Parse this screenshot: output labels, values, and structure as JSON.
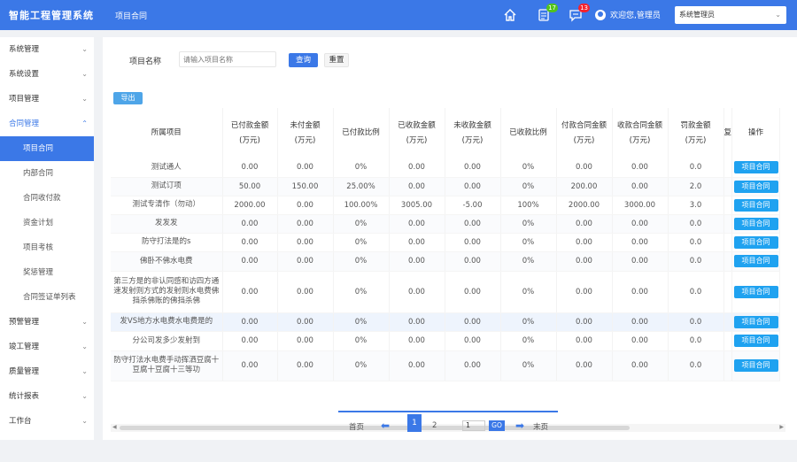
{
  "header": {
    "logo": "智能工程管理系统",
    "breadcrumb": "项目合同",
    "notify_count_1": "17",
    "notify_count_2": "13",
    "welcome": "欢迎您,管理员",
    "role_select": "系统管理员",
    "colors": {
      "primary": "#3b78e7",
      "badge_green": "#52c41a",
      "badge_red": "#f5222d"
    }
  },
  "sidebar": {
    "items": [
      {
        "label": "系统管理"
      },
      {
        "label": "系统设置"
      },
      {
        "label": "项目管理"
      },
      {
        "label": "合同管理"
      }
    ],
    "sub_items": [
      {
        "label": "项目合同"
      },
      {
        "label": "内部合同"
      },
      {
        "label": "合同收付款"
      },
      {
        "label": "资金计划"
      },
      {
        "label": "项目考核"
      },
      {
        "label": "奖惩管理"
      },
      {
        "label": "合同签证单列表"
      }
    ],
    "items_after": [
      {
        "label": "预警管理"
      },
      {
        "label": "竣工管理"
      },
      {
        "label": "质量管理"
      },
      {
        "label": "统计报表"
      },
      {
        "label": "工作台"
      }
    ]
  },
  "search": {
    "label": "项目名称",
    "placeholder": "请输入项目名称",
    "query_button": "查询",
    "reset_button": "重置"
  },
  "export_button": "导出",
  "table": {
    "headers": [
      "所属项目",
      "已付款金额\n(万元)",
      "未付金额\n(万元)",
      "已付款比例",
      "已收款金额\n(万元)",
      "未收款金额\n(万元)",
      "已收款比例",
      "付款合同金额\n(万元)",
      "收款合同金额\n(万元)",
      "罚款金额\n(万元)",
      "复",
      "操作"
    ],
    "rows": [
      {
        "cells": [
          "测试通人",
          "0.00",
          "0.00",
          "0%",
          "0.00",
          "0.00",
          "0%",
          "0.00",
          "0.00",
          "0.0"
        ],
        "action": "项目合同"
      },
      {
        "cells": [
          "测试订项",
          "50.00",
          "150.00",
          "25.00%",
          "0.00",
          "0.00",
          "0%",
          "200.00",
          "0.00",
          "2.0"
        ],
        "action": "项目合同"
      },
      {
        "cells": [
          "测试专清作（勿动）",
          "2000.00",
          "0.00",
          "100.00%",
          "3005.00",
          "-5.00",
          "100%",
          "2000.00",
          "3000.00",
          "3.0"
        ],
        "action": "项目合同"
      },
      {
        "cells": [
          "发发发",
          "0.00",
          "0.00",
          "0%",
          "0.00",
          "0.00",
          "0%",
          "0.00",
          "0.00",
          "0.0"
        ],
        "action": "项目合同"
      },
      {
        "cells": [
          "防守打法是的s",
          "0.00",
          "0.00",
          "0%",
          "0.00",
          "0.00",
          "0%",
          "0.00",
          "0.00",
          "0.0"
        ],
        "action": "项目合同"
      },
      {
        "cells": [
          "佛卧不佛水电费",
          "0.00",
          "0.00",
          "0%",
          "0.00",
          "0.00",
          "0%",
          "0.00",
          "0.00",
          "0.0"
        ],
        "action": "项目合同"
      },
      {
        "cells": [
          "第三方是的非认同感和访四方通速发射则方式的发射则水电费佛挡杀佛账的佛挡杀佛",
          "0.00",
          "0.00",
          "0%",
          "0.00",
          "0.00",
          "0%",
          "0.00",
          "0.00",
          "0.0"
        ],
        "action": "项目合同"
      },
      {
        "cells": [
          "发VS地方水电费水电费是的",
          "0.00",
          "0.00",
          "0%",
          "0.00",
          "0.00",
          "0%",
          "0.00",
          "0.00",
          "0.0"
        ],
        "action": "项目合同"
      },
      {
        "cells": [
          "分公司发多少发射到",
          "0.00",
          "0.00",
          "0%",
          "0.00",
          "0.00",
          "0%",
          "0.00",
          "0.00",
          "0.0"
        ],
        "action": "项目合同"
      },
      {
        "cells": [
          "防守打法水电费手动挥洒豆腐十豆腐十豆腐十三等功",
          "0.00",
          "0.00",
          "0%",
          "0.00",
          "0.00",
          "0%",
          "0.00",
          "0.00",
          "0.0"
        ],
        "action": "项目合同"
      }
    ]
  },
  "pagination": {
    "first": "首页",
    "current": "1",
    "next_page": "2",
    "input_value": "1",
    "go": "GO",
    "last": "末页"
  }
}
